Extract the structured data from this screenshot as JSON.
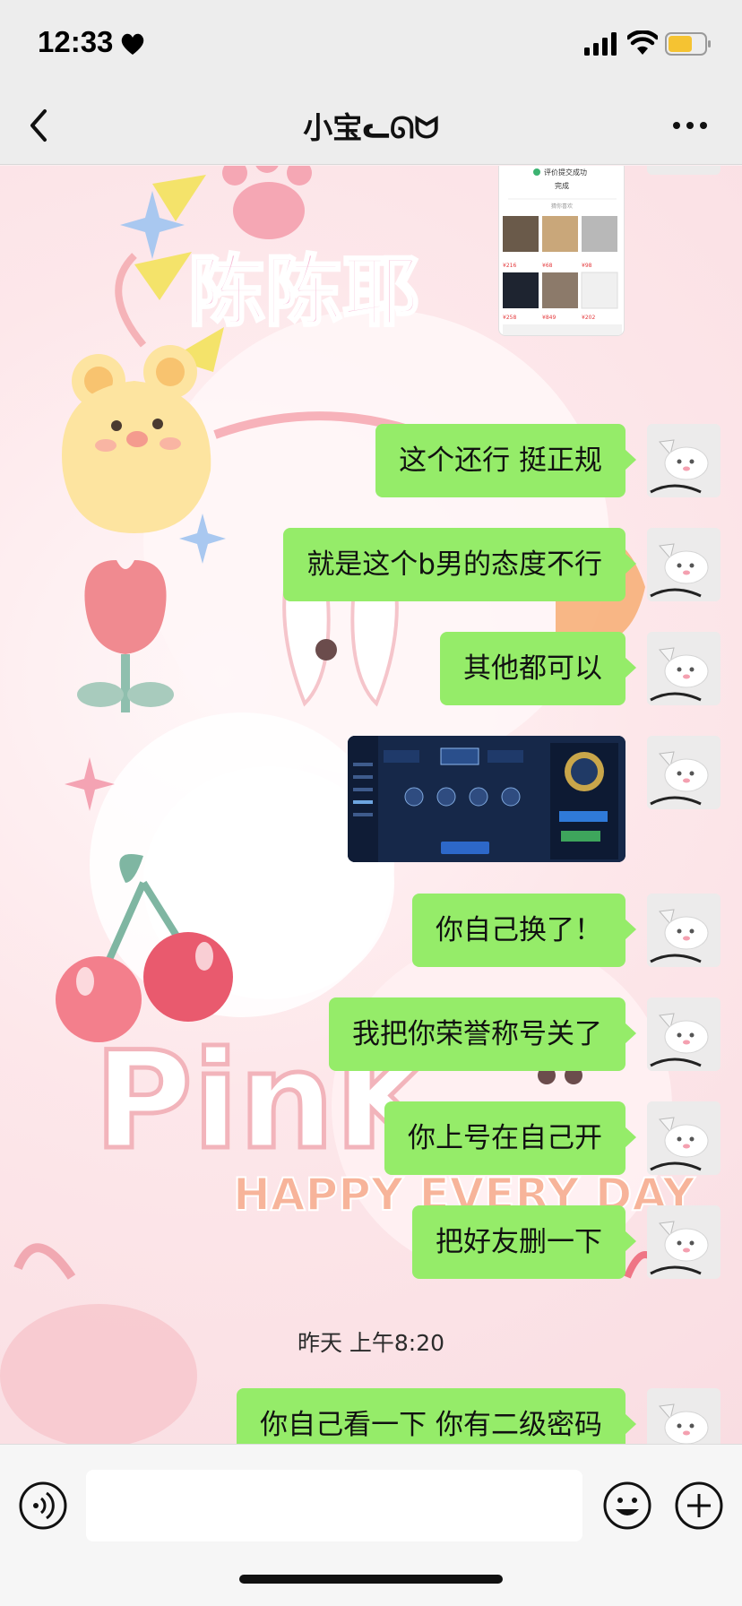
{
  "status_bar": {
    "time": "12:33"
  },
  "header": {
    "title": "小宝ᓚᘏᗢ"
  },
  "messages": [
    {
      "type": "text",
      "text": "这个还行 挺正规"
    },
    {
      "type": "text",
      "text": "就是这个b男的态度不行"
    },
    {
      "type": "text",
      "text": "其他都可以"
    },
    {
      "type": "image",
      "description": "game-screenshot"
    },
    {
      "type": "text",
      "text": "你自己换了！"
    },
    {
      "type": "text",
      "text": "我把你荣誉称号关了"
    },
    {
      "type": "text",
      "text": "你上号在自己开"
    },
    {
      "type": "text",
      "text": "把好友删一下"
    },
    {
      "type": "time",
      "text": "昨天 上午8:20"
    },
    {
      "type": "text",
      "text": "你自己看一下 你有二级密码"
    }
  ],
  "shop_preview": {
    "status": "评价提交成功",
    "button": "完成",
    "section": "猜你喜欢",
    "prices": [
      "¥216",
      "¥68",
      "¥98",
      "¥258",
      "¥849",
      "¥202"
    ]
  },
  "wallpaper_text": {
    "title": "陈陈耶",
    "pink": "PinK",
    "happy": "HAPPY EVERY DAY"
  },
  "colors": {
    "bubble": "#95ec69",
    "bar": "#ededed",
    "wallpaper": "#fbeef0"
  },
  "input": {
    "placeholder": ""
  }
}
